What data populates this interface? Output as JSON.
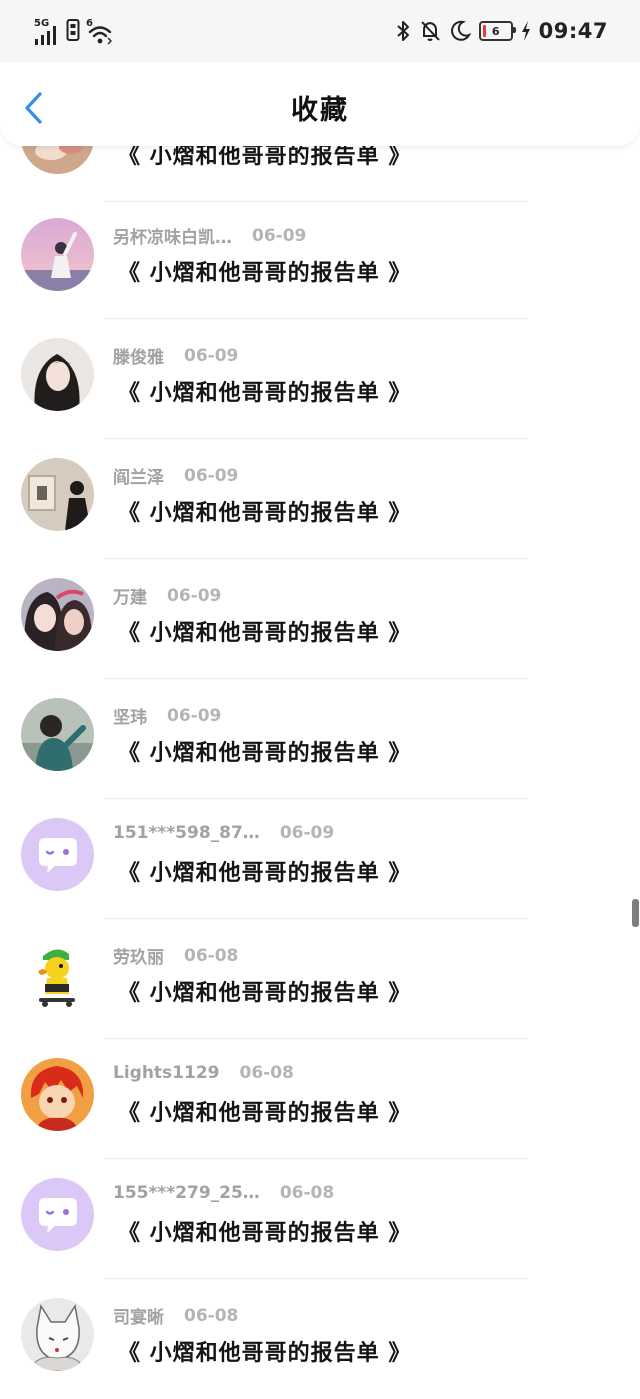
{
  "status_bar": {
    "network": "5G",
    "wifi_badge": "6",
    "battery": "6",
    "time": "09:47"
  },
  "nav": {
    "title": "收藏"
  },
  "items": [
    {
      "name": "",
      "date": "",
      "title": "《 小熠和他哥哥的报告单 》",
      "avatar": "photo-hands"
    },
    {
      "name": "另杯凉味白凯…",
      "date": "06-09",
      "title": "《 小熠和他哥哥的报告单 》",
      "avatar": "photo-sunset-girl"
    },
    {
      "name": "滕俊雅",
      "date": "06-09",
      "title": "《 小熠和他哥哥的报告单 》",
      "avatar": "photo-woman-portrait"
    },
    {
      "name": "阎兰泽",
      "date": "06-09",
      "title": "《 小熠和他哥哥的报告单 》",
      "avatar": "photo-gallery"
    },
    {
      "name": "万建",
      "date": "06-09",
      "title": "《 小熠和他哥哥的报告单 》",
      "avatar": "photo-two-girls"
    },
    {
      "name": "坚玮",
      "date": "06-09",
      "title": "《 小熠和他哥哥的报告单 》",
      "avatar": "photo-child"
    },
    {
      "name": "151***598_87…",
      "date": "06-09",
      "title": "《 小熠和他哥哥的报告单 》",
      "avatar": "default-chat-avatar"
    },
    {
      "name": "劳玖丽",
      "date": "06-08",
      "title": "《 小熠和他哥哥的报告单 》",
      "avatar": "cartoon-duck"
    },
    {
      "name": "Lights1129",
      "date": "06-08",
      "title": "《 小熠和他哥哥的报告单 》",
      "avatar": "anime-boy"
    },
    {
      "name": "155***279_25…",
      "date": "06-08",
      "title": "《 小熠和他哥哥的报告单 》",
      "avatar": "default-chat-avatar"
    },
    {
      "name": "司宴晰",
      "date": "06-08",
      "title": "《 小熠和他哥哥的报告单 》",
      "avatar": "sketch-fox"
    }
  ],
  "colors": {
    "accent": "#2f8fea",
    "default_avatar_bg": "#dcc8f7"
  }
}
